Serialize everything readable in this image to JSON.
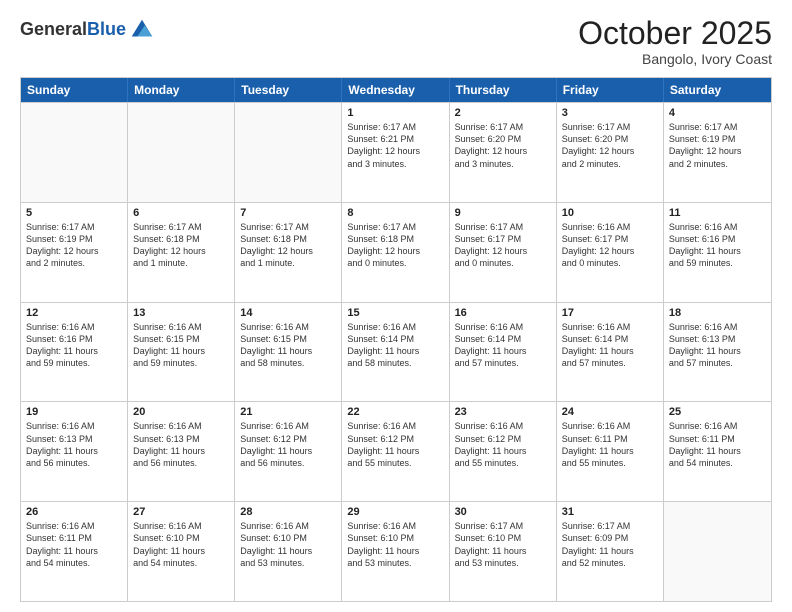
{
  "header": {
    "logo_general": "General",
    "logo_blue": "Blue",
    "month": "October 2025",
    "location": "Bangolo, Ivory Coast"
  },
  "days_of_week": [
    "Sunday",
    "Monday",
    "Tuesday",
    "Wednesday",
    "Thursday",
    "Friday",
    "Saturday"
  ],
  "rows": [
    [
      {
        "day": "",
        "info": ""
      },
      {
        "day": "",
        "info": ""
      },
      {
        "day": "",
        "info": ""
      },
      {
        "day": "1",
        "info": "Sunrise: 6:17 AM\nSunset: 6:21 PM\nDaylight: 12 hours\nand 3 minutes."
      },
      {
        "day": "2",
        "info": "Sunrise: 6:17 AM\nSunset: 6:20 PM\nDaylight: 12 hours\nand 3 minutes."
      },
      {
        "day": "3",
        "info": "Sunrise: 6:17 AM\nSunset: 6:20 PM\nDaylight: 12 hours\nand 2 minutes."
      },
      {
        "day": "4",
        "info": "Sunrise: 6:17 AM\nSunset: 6:19 PM\nDaylight: 12 hours\nand 2 minutes."
      }
    ],
    [
      {
        "day": "5",
        "info": "Sunrise: 6:17 AM\nSunset: 6:19 PM\nDaylight: 12 hours\nand 2 minutes."
      },
      {
        "day": "6",
        "info": "Sunrise: 6:17 AM\nSunset: 6:18 PM\nDaylight: 12 hours\nand 1 minute."
      },
      {
        "day": "7",
        "info": "Sunrise: 6:17 AM\nSunset: 6:18 PM\nDaylight: 12 hours\nand 1 minute."
      },
      {
        "day": "8",
        "info": "Sunrise: 6:17 AM\nSunset: 6:18 PM\nDaylight: 12 hours\nand 0 minutes."
      },
      {
        "day": "9",
        "info": "Sunrise: 6:17 AM\nSunset: 6:17 PM\nDaylight: 12 hours\nand 0 minutes."
      },
      {
        "day": "10",
        "info": "Sunrise: 6:16 AM\nSunset: 6:17 PM\nDaylight: 12 hours\nand 0 minutes."
      },
      {
        "day": "11",
        "info": "Sunrise: 6:16 AM\nSunset: 6:16 PM\nDaylight: 11 hours\nand 59 minutes."
      }
    ],
    [
      {
        "day": "12",
        "info": "Sunrise: 6:16 AM\nSunset: 6:16 PM\nDaylight: 11 hours\nand 59 minutes."
      },
      {
        "day": "13",
        "info": "Sunrise: 6:16 AM\nSunset: 6:15 PM\nDaylight: 11 hours\nand 59 minutes."
      },
      {
        "day": "14",
        "info": "Sunrise: 6:16 AM\nSunset: 6:15 PM\nDaylight: 11 hours\nand 58 minutes."
      },
      {
        "day": "15",
        "info": "Sunrise: 6:16 AM\nSunset: 6:14 PM\nDaylight: 11 hours\nand 58 minutes."
      },
      {
        "day": "16",
        "info": "Sunrise: 6:16 AM\nSunset: 6:14 PM\nDaylight: 11 hours\nand 57 minutes."
      },
      {
        "day": "17",
        "info": "Sunrise: 6:16 AM\nSunset: 6:14 PM\nDaylight: 11 hours\nand 57 minutes."
      },
      {
        "day": "18",
        "info": "Sunrise: 6:16 AM\nSunset: 6:13 PM\nDaylight: 11 hours\nand 57 minutes."
      }
    ],
    [
      {
        "day": "19",
        "info": "Sunrise: 6:16 AM\nSunset: 6:13 PM\nDaylight: 11 hours\nand 56 minutes."
      },
      {
        "day": "20",
        "info": "Sunrise: 6:16 AM\nSunset: 6:13 PM\nDaylight: 11 hours\nand 56 minutes."
      },
      {
        "day": "21",
        "info": "Sunrise: 6:16 AM\nSunset: 6:12 PM\nDaylight: 11 hours\nand 56 minutes."
      },
      {
        "day": "22",
        "info": "Sunrise: 6:16 AM\nSunset: 6:12 PM\nDaylight: 11 hours\nand 55 minutes."
      },
      {
        "day": "23",
        "info": "Sunrise: 6:16 AM\nSunset: 6:12 PM\nDaylight: 11 hours\nand 55 minutes."
      },
      {
        "day": "24",
        "info": "Sunrise: 6:16 AM\nSunset: 6:11 PM\nDaylight: 11 hours\nand 55 minutes."
      },
      {
        "day": "25",
        "info": "Sunrise: 6:16 AM\nSunset: 6:11 PM\nDaylight: 11 hours\nand 54 minutes."
      }
    ],
    [
      {
        "day": "26",
        "info": "Sunrise: 6:16 AM\nSunset: 6:11 PM\nDaylight: 11 hours\nand 54 minutes."
      },
      {
        "day": "27",
        "info": "Sunrise: 6:16 AM\nSunset: 6:10 PM\nDaylight: 11 hours\nand 54 minutes."
      },
      {
        "day": "28",
        "info": "Sunrise: 6:16 AM\nSunset: 6:10 PM\nDaylight: 11 hours\nand 53 minutes."
      },
      {
        "day": "29",
        "info": "Sunrise: 6:16 AM\nSunset: 6:10 PM\nDaylight: 11 hours\nand 53 minutes."
      },
      {
        "day": "30",
        "info": "Sunrise: 6:17 AM\nSunset: 6:10 PM\nDaylight: 11 hours\nand 53 minutes."
      },
      {
        "day": "31",
        "info": "Sunrise: 6:17 AM\nSunset: 6:09 PM\nDaylight: 11 hours\nand 52 minutes."
      },
      {
        "day": "",
        "info": ""
      }
    ]
  ]
}
